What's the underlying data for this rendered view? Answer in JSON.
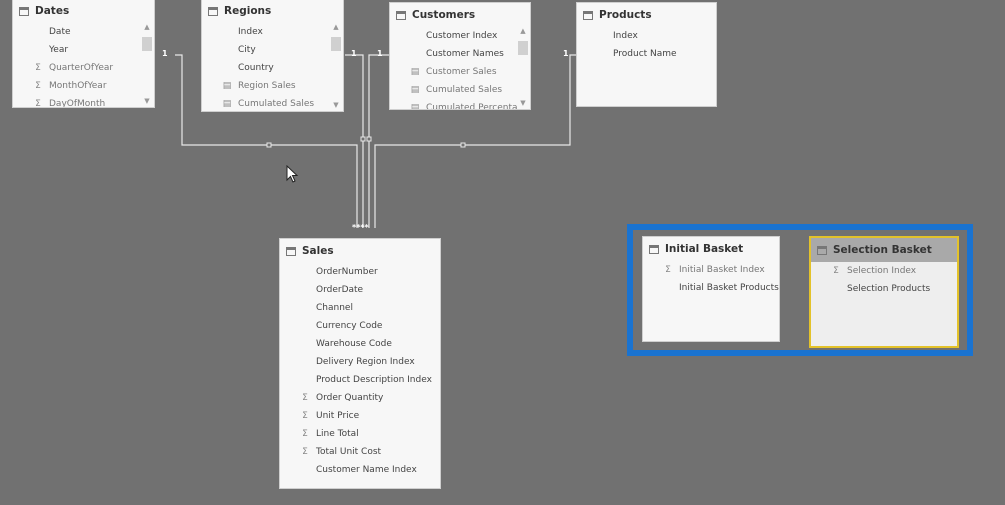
{
  "tables": {
    "dates": {
      "title": "Dates",
      "fields": [
        {
          "label": "Date",
          "icon": ""
        },
        {
          "label": "Year",
          "icon": ""
        },
        {
          "label": "QuarterOfYear",
          "icon": "sigma"
        },
        {
          "label": "MonthOfYear",
          "icon": "sigma"
        },
        {
          "label": "DayOfMonth",
          "icon": "sigma"
        }
      ]
    },
    "regions": {
      "title": "Regions",
      "fields": [
        {
          "label": "Index",
          "icon": ""
        },
        {
          "label": "City",
          "icon": ""
        },
        {
          "label": "Country",
          "icon": ""
        },
        {
          "label": "Region Sales",
          "icon": "measure"
        },
        {
          "label": "Cumulated Sales",
          "icon": "measure"
        }
      ]
    },
    "customers": {
      "title": "Customers",
      "fields": [
        {
          "label": "Customer Index",
          "icon": ""
        },
        {
          "label": "Customer Names",
          "icon": ""
        },
        {
          "label": "Customer Sales",
          "icon": "measure"
        },
        {
          "label": "Cumulated Sales",
          "icon": "measure"
        },
        {
          "label": "Cumulated Percenta",
          "icon": "measure"
        }
      ]
    },
    "products": {
      "title": "Products",
      "fields": [
        {
          "label": "Index",
          "icon": ""
        },
        {
          "label": "Product Name",
          "icon": ""
        }
      ]
    },
    "sales": {
      "title": "Sales",
      "fields": [
        {
          "label": "OrderNumber",
          "icon": ""
        },
        {
          "label": "OrderDate",
          "icon": ""
        },
        {
          "label": "Channel",
          "icon": ""
        },
        {
          "label": "Currency Code",
          "icon": ""
        },
        {
          "label": "Warehouse Code",
          "icon": ""
        },
        {
          "label": "Delivery Region Index",
          "icon": ""
        },
        {
          "label": "Product Description Index",
          "icon": ""
        },
        {
          "label": "Order Quantity",
          "icon": "sigma"
        },
        {
          "label": "Unit Price",
          "icon": "sigma"
        },
        {
          "label": "Line Total",
          "icon": "sigma"
        },
        {
          "label": "Total Unit Cost",
          "icon": "sigma"
        },
        {
          "label": "Customer Name Index",
          "icon": ""
        }
      ]
    },
    "initial_basket": {
      "title": "Initial Basket",
      "fields": [
        {
          "label": "Initial Basket Index",
          "icon": "sigma"
        },
        {
          "label": "Initial Basket Products",
          "icon": ""
        }
      ]
    },
    "selection_basket": {
      "title": "Selection Basket",
      "fields": [
        {
          "label": "Selection Index",
          "icon": "sigma"
        },
        {
          "label": "Selection Products",
          "icon": ""
        }
      ]
    }
  },
  "relationships": {
    "one_label": "1",
    "many_label": "****"
  },
  "colors": {
    "canvas": "#717171",
    "selection_group": "#1a73d0",
    "selected_table": "#e3c22a"
  }
}
